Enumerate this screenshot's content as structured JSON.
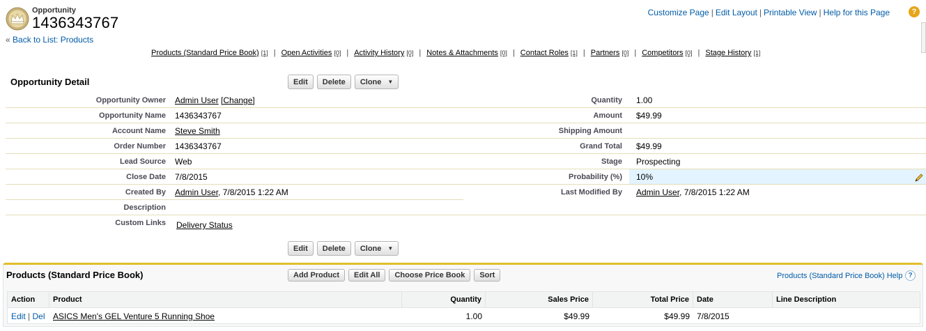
{
  "header": {
    "object_type": "Opportunity",
    "record_name": "1436343767",
    "back_prefix": "«",
    "back_link": "Back to List: Products",
    "top_links": [
      "Customize Page",
      "Edit Layout",
      "Printable View",
      "Help for this Page"
    ],
    "help_icon": "?"
  },
  "related_links": [
    {
      "label": "Products (Standard Price Book)",
      "count": "[1]"
    },
    {
      "label": "Open Activities",
      "count": "[0]"
    },
    {
      "label": "Activity History",
      "count": "[0]"
    },
    {
      "label": "Notes & Attachments",
      "count": "[0]"
    },
    {
      "label": "Contact Roles",
      "count": "[1]"
    },
    {
      "label": "Partners",
      "count": "[0]"
    },
    {
      "label": "Competitors",
      "count": "[0]"
    },
    {
      "label": "Stage History",
      "count": "[1]"
    }
  ],
  "detail": {
    "title": "Opportunity Detail",
    "buttons": {
      "edit": "Edit",
      "delete": "Delete",
      "clone": "Clone"
    },
    "left_fields": [
      {
        "label": "Opportunity Owner",
        "value": "Admin User",
        "extra": "[Change]"
      },
      {
        "label": "Opportunity Name",
        "value": "1436343767"
      },
      {
        "label": "Account Name",
        "value": "Steve Smith"
      },
      {
        "label": "Order Number",
        "value": "1436343767"
      },
      {
        "label": "Lead Source",
        "value": "Web"
      },
      {
        "label": "Close Date",
        "value": "7/8/2015"
      },
      {
        "label": "Created By",
        "value": "Admin User",
        "extra": ", 7/8/2015 1:22 AM"
      },
      {
        "label": "Description",
        "value": ""
      },
      {
        "label": "Custom Links",
        "value": "Delivery Status"
      }
    ],
    "right_fields": [
      {
        "label": "Quantity",
        "value": "1.00"
      },
      {
        "label": "Amount",
        "value": "$49.99"
      },
      {
        "label": "Shipping Amount",
        "value": ""
      },
      {
        "label": "Grand Total",
        "value": "$49.99"
      },
      {
        "label": "Stage",
        "value": "Prospecting"
      },
      {
        "label": "Probability (%)",
        "value": "10%"
      },
      {
        "label": "Last Modified By",
        "value": "Admin User",
        "extra": ", 7/8/2015 1:22 AM"
      }
    ]
  },
  "products": {
    "title": "Products (Standard Price Book)",
    "buttons": [
      "Add Product",
      "Edit All",
      "Choose Price Book",
      "Sort"
    ],
    "help_link": "Products (Standard Price Book) Help",
    "help_icon": "?",
    "columns": [
      "Action",
      "Product",
      "Quantity",
      "Sales Price",
      "Total Price",
      "Date",
      "Line Description"
    ],
    "rows": [
      {
        "edit": "Edit",
        "sep": "|",
        "del": "Del",
        "product": "ASICS Men's GEL Venture 5 Running Shoe",
        "quantity": "1.00",
        "sales_price": "$49.99",
        "total_price": "$49.99",
        "date": "7/8/2015",
        "line_description": ""
      }
    ]
  },
  "colors": {
    "link": "#015ba7",
    "accent_gold": "#e1be2b",
    "row_border": "#e3deb8",
    "highlight": "#e3f3ff"
  },
  "icons": [
    "opportunity-crown-icon",
    "help-icon",
    "pencil-icon",
    "question-mark-icon",
    "dropdown-caret-icon"
  ]
}
